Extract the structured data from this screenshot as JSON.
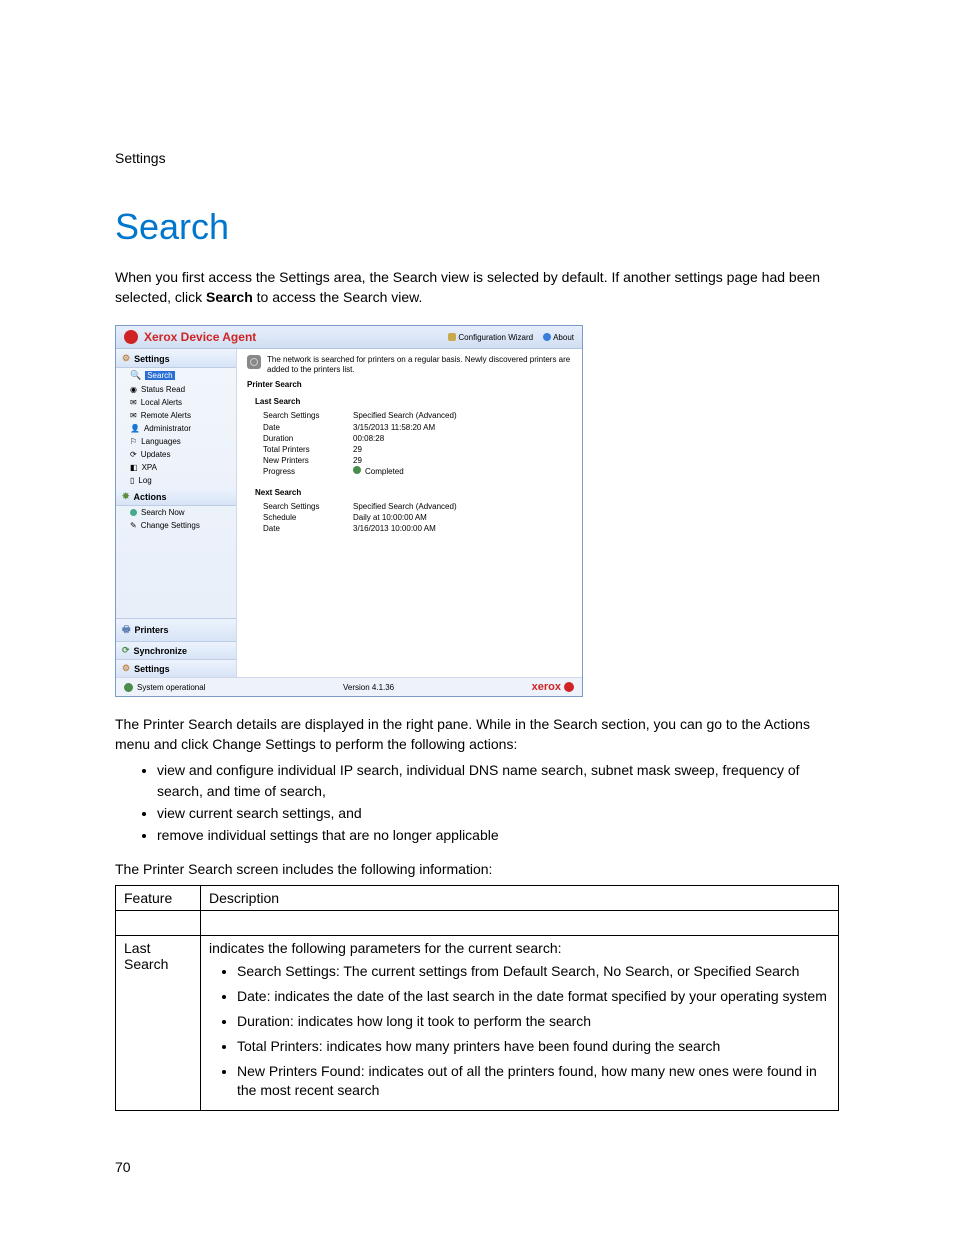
{
  "header_label": "Settings",
  "page_title": "Search",
  "intro_prefix": "When you first access the Settings area, the Search view is selected by default. If another settings page had been selected, click ",
  "intro_bold": "Search",
  "intro_suffix": " to access the Search view.",
  "app": {
    "title": "Xerox Device Agent",
    "config_wizard": "Configuration Wizard",
    "about": "About",
    "sidebar": {
      "settings_header": "Settings",
      "items": [
        "Search",
        "Status Read",
        "Local Alerts",
        "Remote Alerts",
        "Administrator",
        "Languages",
        "Updates",
        "XPA",
        "Log"
      ],
      "actions_header": "Actions",
      "actions": [
        "Search Now",
        "Change Settings"
      ],
      "bottom": [
        "Printers",
        "Synchronize",
        "Settings"
      ]
    },
    "main": {
      "info_text": "The network is searched for printers on a regular basis. Newly discovered printers are added to the printers list.",
      "pane_title": "Printer Search",
      "last_search": {
        "heading": "Last Search",
        "rows": {
          "Search Settings": "Specified Search (Advanced)",
          "Date": "3/15/2013 11:58:20 AM",
          "Duration": "00:08:28",
          "Total Printers": "29",
          "New Printers": "29",
          "Progress": "Completed"
        }
      },
      "next_search": {
        "heading": "Next Search",
        "rows": {
          "Search Settings": "Specified Search  (Advanced)",
          "Schedule": "Daily at 10:00:00 AM",
          "Date": "3/16/2013 10:00:00 AM"
        }
      }
    },
    "footer": {
      "status": "System operational",
      "version": "Version  4.1.36",
      "brand": "xerox"
    }
  },
  "para_after_shot": "The Printer Search details are displayed in the right pane. While in the Search section, you can go to the Actions menu and click Change Settings to perform the following actions:",
  "action_bullets": [
    "view and configure individual IP search, individual DNS name search, subnet mask sweep, frequency of search, and time of search,",
    "view current search settings, and",
    "remove individual settings that are no longer applicable"
  ],
  "table_intro": "The Printer Search screen includes the following information:",
  "table": {
    "head": {
      "col1": "Feature",
      "col2": "Description"
    },
    "row": {
      "feature": "Last Search",
      "desc_intro": "indicates the following parameters for the current search:",
      "items": [
        "Search Settings: The current settings from Default Search, No Search, or Specified Search",
        "Date: indicates the date of the last search in the date format specified by your operating system",
        "Duration: indicates how long it took to perform the search",
        "Total Printers: indicates how many printers have been found during the search",
        "New Printers Found: indicates out of all the printers found, how many new ones were found in the most recent search"
      ]
    }
  },
  "page_number": "70"
}
